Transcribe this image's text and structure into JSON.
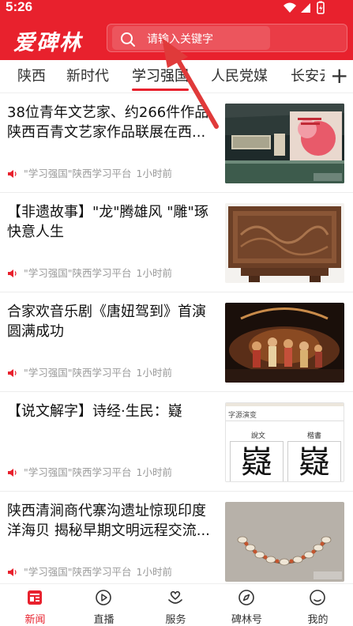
{
  "status_bar": {
    "time": "5:26"
  },
  "header": {
    "logo": "爱碑林",
    "search": {
      "placeholder": "请输入关键字"
    }
  },
  "tabs": [
    {
      "label": "陕西"
    },
    {
      "label": "新时代"
    },
    {
      "label": "学习强国",
      "active": true
    },
    {
      "label": "人民党媒"
    },
    {
      "label": "长安云"
    }
  ],
  "articles": [
    {
      "title": "38位青年文艺家、约266件作品陕西百青文艺家作品联展在西...",
      "source": "\"学习强国\"陕西学习平台",
      "time": "1小时前",
      "thumb": "exhibition-hall"
    },
    {
      "title": "【非遗故事】\"龙\"腾雄风 \"雕\"琢快意人生",
      "source": "\"学习强国\"陕西学习平台",
      "time": "1小时前",
      "thumb": "carved-screen"
    },
    {
      "title": "合家欢音乐剧《唐妞驾到》首演圆满成功",
      "source": "\"学习强国\"陕西学习平台",
      "time": "1小时前",
      "thumb": "stage-performance"
    },
    {
      "title": "【说文解字】诗经·生民：嶷",
      "source": "\"学习强国\"陕西学习平台",
      "time": "1小时前",
      "thumb": "character-evolution",
      "thumb_text": {
        "header": "字源演变",
        "col1": "說文",
        "col2": "楷書",
        "glyph1": "嶷",
        "glyph2": "嶷"
      }
    },
    {
      "title": "陕西清涧商代寨沟遗址惊现印度洋海贝 揭秘早期文明远程交流...",
      "source": "\"学习强国\"陕西学习平台",
      "time": "1小时前",
      "thumb": "shell-necklace"
    }
  ],
  "bottom_nav": [
    {
      "label": "新闻",
      "icon": "news-icon",
      "active": true
    },
    {
      "label": "直播",
      "icon": "live-play-icon"
    },
    {
      "label": "服务",
      "icon": "service-heart-icon"
    },
    {
      "label": "碑林号",
      "icon": "compass-icon"
    },
    {
      "label": "我的",
      "icon": "profile-icon"
    }
  ],
  "colors": {
    "brand_red": "#e8212d"
  }
}
